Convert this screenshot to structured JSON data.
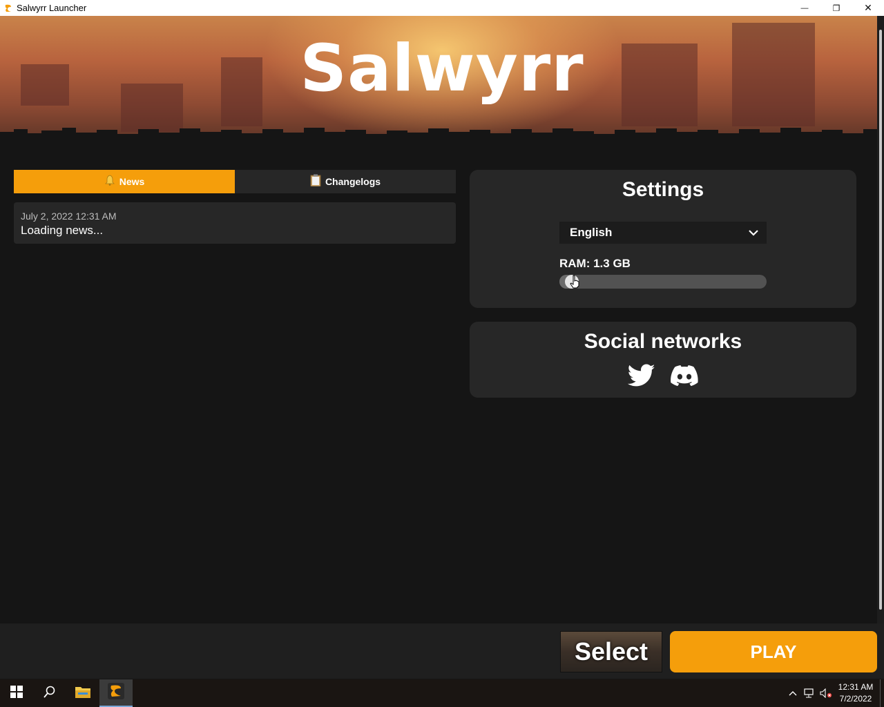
{
  "window": {
    "title": "Salwyrr Launcher",
    "minimize": "—",
    "restore": "❐",
    "close": "✕"
  },
  "hero": {
    "logo_text": "Salwyrr"
  },
  "tabs": [
    {
      "label": "News",
      "icon": "bell-icon",
      "active": true
    },
    {
      "label": "Changelogs",
      "icon": "clipboard-icon",
      "active": false
    }
  ],
  "news": {
    "date": "July 2, 2022 12:31 AM",
    "text": "Loading news..."
  },
  "settings": {
    "title": "Settings",
    "language": "English",
    "ram_label": "RAM: 1.3 GB",
    "ram_fraction": 0.03
  },
  "social": {
    "title": "Social networks",
    "links": [
      "twitter-icon",
      "discord-icon"
    ]
  },
  "bottom": {
    "select_label": "Select",
    "play_label": "PLAY"
  },
  "taskbar": {
    "time": "12:31 AM",
    "date": "7/2/2022"
  },
  "colors": {
    "accent": "#f59e0b",
    "panel": "#272727",
    "background": "#151515"
  }
}
